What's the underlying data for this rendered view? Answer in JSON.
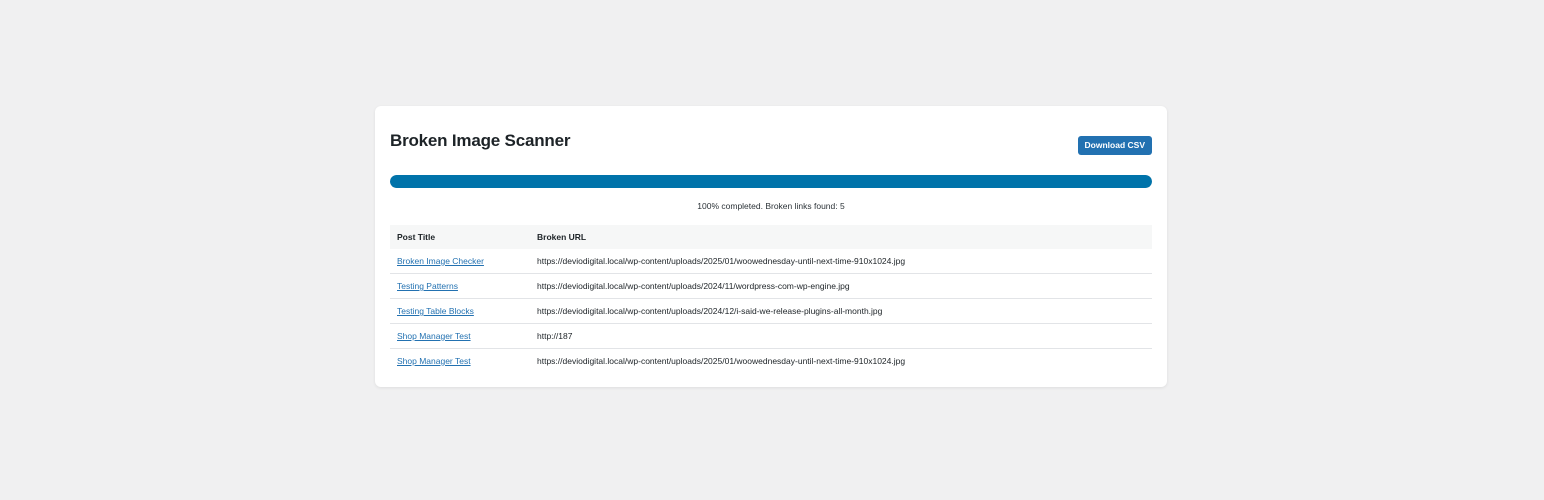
{
  "page": {
    "title": "Broken Image Scanner",
    "download_label": "Download CSV"
  },
  "progress": {
    "percent": 100,
    "status_text": "100% completed. Broken links found: 5"
  },
  "table": {
    "headers": [
      "Post Title",
      "Broken URL"
    ],
    "rows": [
      {
        "post_title": "Broken Image Checker",
        "url": "https://deviodigital.local/wp-content/uploads/2025/01/woowednesday-until-next-time-910x1024.jpg"
      },
      {
        "post_title": "Testing Patterns",
        "url": "https://deviodigital.local/wp-content/uploads/2024/11/wordpress-com-wp-engine.jpg"
      },
      {
        "post_title": "Testing Table Blocks",
        "url": "https://deviodigital.local/wp-content/uploads/2024/12/i-said-we-release-plugins-all-month.jpg"
      },
      {
        "post_title": "Shop Manager Test",
        "url": "http://187"
      },
      {
        "post_title": "Shop Manager Test",
        "url": "https://deviodigital.local/wp-content/uploads/2025/01/woowednesday-until-next-time-910x1024.jpg"
      }
    ]
  },
  "colors": {
    "page_background": "#f0f0f1",
    "accent": "#2271b1",
    "progress_fill": "#0073aa"
  }
}
